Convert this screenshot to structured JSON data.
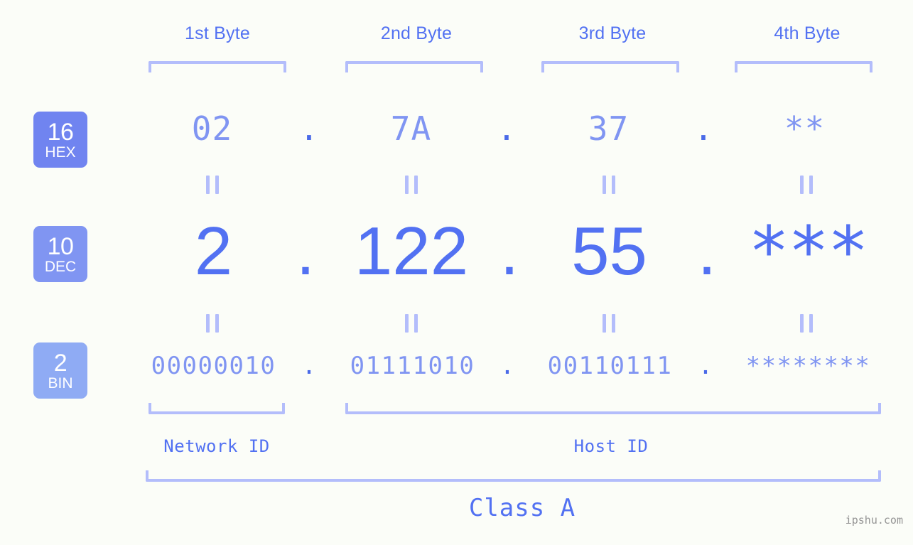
{
  "background_color": "#fbfdf8",
  "accent_color": "#5271f2",
  "accent_light_color": "#8095f2",
  "bracket_color": "#b3bdfb",
  "byte_headers": [
    {
      "label": "1st Byte"
    },
    {
      "label": "2nd Byte"
    },
    {
      "label": "3rd Byte"
    },
    {
      "label": "4th Byte"
    }
  ],
  "bases": [
    {
      "number": "16",
      "name": "HEX",
      "color": "#7084f0"
    },
    {
      "number": "10",
      "name": "DEC",
      "color": "#8095f2"
    },
    {
      "number": "2",
      "name": "BIN",
      "color": "#8fabf4"
    }
  ],
  "separator": ".",
  "equals_symbol": "=",
  "rows": {
    "hex": {
      "values": [
        "02",
        "7A",
        "37",
        "**"
      ]
    },
    "dec": {
      "values": [
        "2",
        "122",
        "55",
        "***"
      ]
    },
    "bin": {
      "values": [
        "00000010",
        "01111010",
        "00110111",
        "********"
      ]
    }
  },
  "id_sections": [
    {
      "label": "Network ID"
    },
    {
      "label": "Host ID"
    }
  ],
  "class": {
    "label": "Class A"
  },
  "watermark": {
    "text": "ipshu.com"
  }
}
